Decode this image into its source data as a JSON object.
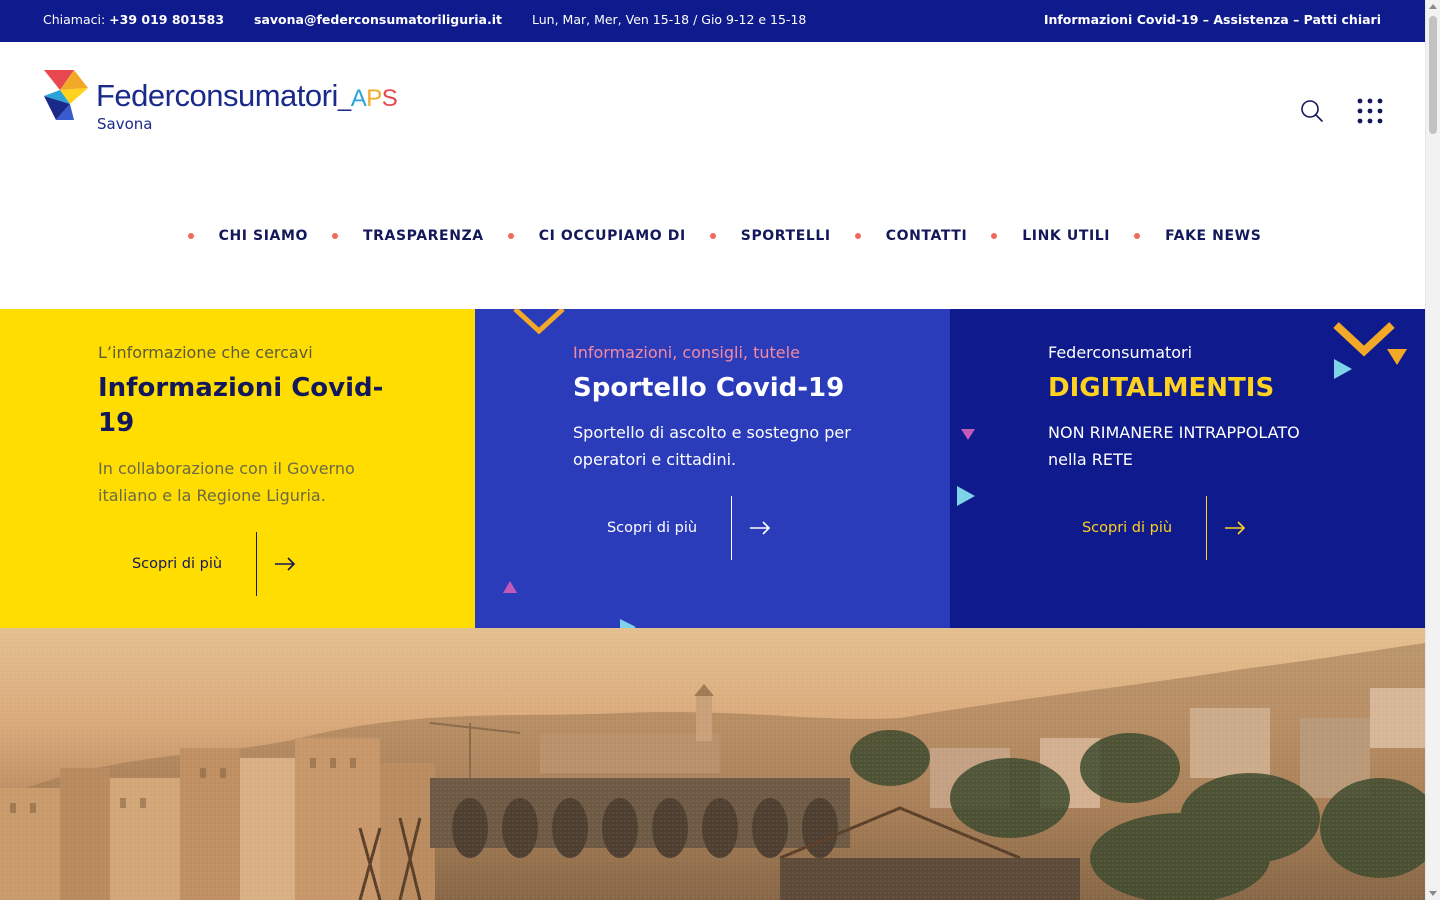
{
  "topbar": {
    "phone_label": "Chiamaci:",
    "phone": "+39 019 801583",
    "email": "savona@federconsumatoriliguria.it",
    "hours": "Lun, Mar, Mer, Ven  15-18 / Gio 9-12 e 15-18",
    "right_links": "Informazioni Covid-19 – Assistenza – Patti chiari"
  },
  "logo": {
    "name": "Federconsumatori",
    "suffix_underscore": "_",
    "suffix_a": "A",
    "suffix_p": "P",
    "suffix_s": "S",
    "subtitle": "Savona"
  },
  "header_icons": [
    "search-icon",
    "grid-menu-icon"
  ],
  "nav": [
    {
      "label": "CHI SIAMO"
    },
    {
      "label": "TRASPARENZA"
    },
    {
      "label": "CI OCCUPIAMO DI"
    },
    {
      "label": "SPORTELLI"
    },
    {
      "label": "CONTATTI"
    },
    {
      "label": "LINK UTILI"
    },
    {
      "label": "FAKE NEWS"
    }
  ],
  "panels": [
    {
      "kicker": "L’informazione che cercavi",
      "title": "Informazioni Covid-19",
      "description": "In collaborazione con il Governo italiano e la Regione Liguria.",
      "cta": "Scopri di più",
      "colors": {
        "bg": "#ffdd00",
        "kicker": "#5b5a3a",
        "title": "#13185a",
        "text": "#6b6a48",
        "cta": "#13185a"
      }
    },
    {
      "kicker": "Informazioni, consigli, tutele",
      "title": "Sportello Covid-19",
      "description": "Sportello di ascolto e sostegno per operatori e cittadini.",
      "cta": "Scopri di più",
      "colors": {
        "bg": "#2b3cbb",
        "kicker": "#f48aa0",
        "title": "#ffffff",
        "text": "#ffffff",
        "cta": "#ffffff"
      }
    },
    {
      "kicker": "Federconsumatori",
      "title": "DIGITALMENTIS",
      "description": "NON RIMANERE INTRAPPOLATO nella RETE",
      "cta": "Scopri di più",
      "colors": {
        "bg": "#0f1b8c",
        "kicker": "#ffffff",
        "title": "#ffd21f",
        "text": "#ffffff",
        "cta": "#ffd21f"
      }
    }
  ],
  "colors": {
    "brand_blue": "#0f1b8c",
    "accent_dot": "#f06a5b",
    "yellow": "#ffdd00"
  }
}
